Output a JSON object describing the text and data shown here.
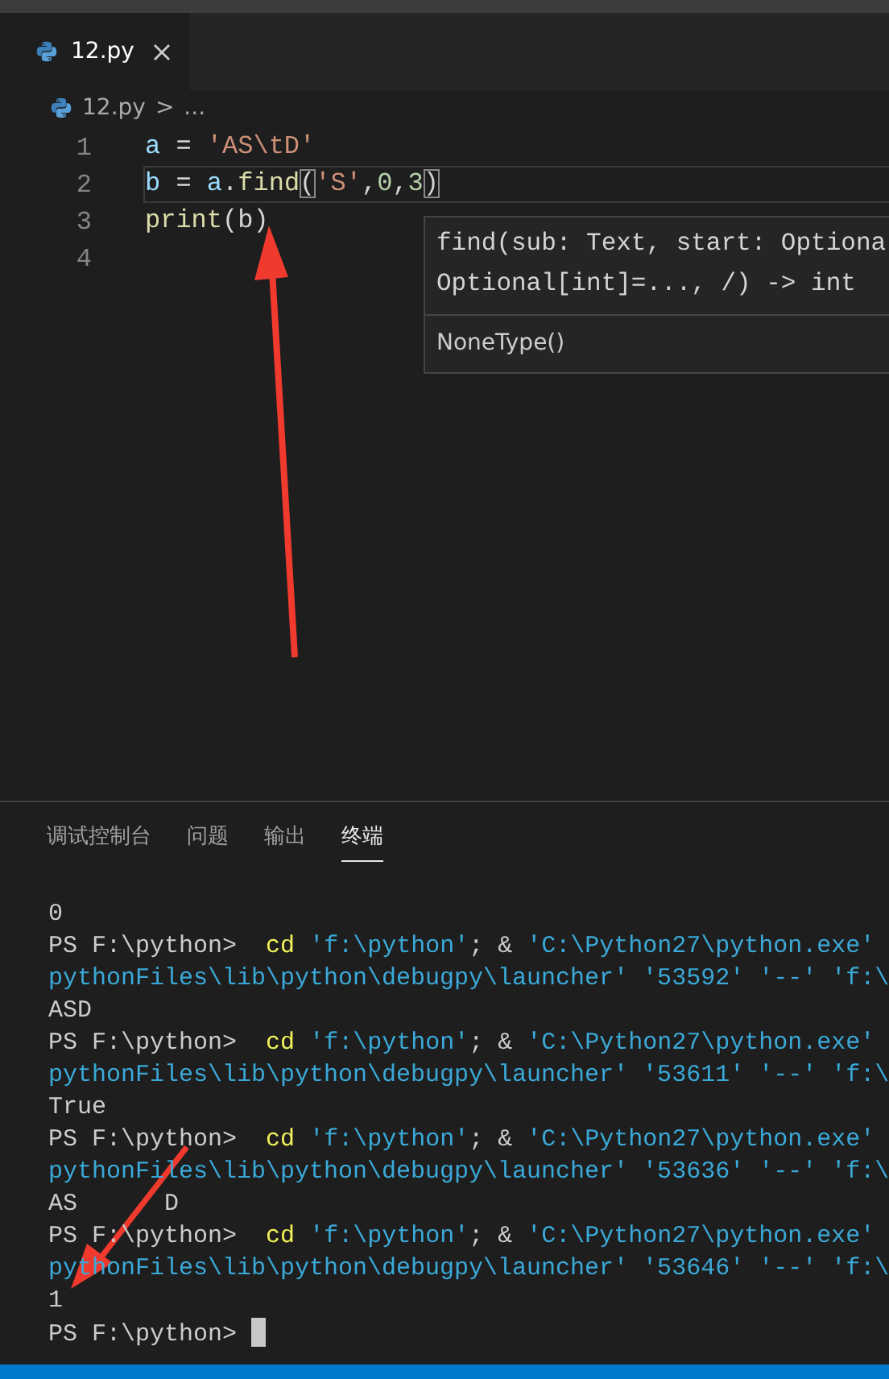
{
  "tabs": [
    {
      "label": "12.py",
      "selected": true
    }
  ],
  "breadcrumb": {
    "file": "12.py",
    "separator": ">",
    "rest": "..."
  },
  "code": [
    {
      "number": "1",
      "current": false,
      "tokens": [
        {
          "kind": "var",
          "text": "a"
        },
        {
          "kind": "op",
          "text": " = "
        },
        {
          "kind": "str",
          "text": "'AS\\tD'"
        }
      ]
    },
    {
      "number": "2",
      "current": true,
      "tokens": [
        {
          "kind": "var",
          "text": "b"
        },
        {
          "kind": "op",
          "text": " = "
        },
        {
          "kind": "var",
          "text": "a"
        },
        {
          "kind": "op",
          "text": "."
        },
        {
          "kind": "fn",
          "text": "find"
        },
        {
          "kind": "bracket",
          "text": "("
        },
        {
          "kind": "str",
          "text": "'S'"
        },
        {
          "kind": "op",
          "text": ","
        },
        {
          "kind": "num",
          "text": "0"
        },
        {
          "kind": "op",
          "text": ","
        },
        {
          "kind": "num",
          "text": "3"
        },
        {
          "kind": "bracket",
          "text": ")"
        }
      ]
    },
    {
      "number": "3",
      "current": false,
      "tokens": [
        {
          "kind": "fn",
          "text": "print"
        },
        {
          "kind": "op",
          "text": "(b)"
        }
      ]
    },
    {
      "number": "4",
      "current": false
    }
  ],
  "hover": {
    "signature": [
      "find(sub: Text, start: Optiona",
      "Optional[int]=..., /) -> int"
    ],
    "doc": "NoneType()"
  },
  "panel_tabs": [
    {
      "label": "调试控制台",
      "selected": false
    },
    {
      "label": "问题",
      "selected": false
    },
    {
      "label": "输出",
      "selected": false
    },
    {
      "label": "终端",
      "selected": true
    }
  ],
  "terminal": [
    {
      "kind": "output",
      "text": "0"
    },
    {
      "kind": "command",
      "prompt": "PS F:\\python>",
      "command": "cd",
      "args": [
        {
          "kind": "str",
          "text": "'f:\\python'"
        },
        {
          "kind": "plain",
          "text": "; & "
        },
        {
          "kind": "str",
          "text": "'C:\\Python27\\python.exe'"
        }
      ]
    },
    {
      "kind": "continuation",
      "text": "pythonFiles\\lib\\python\\debugpy\\launcher' '53592' '--' 'f:\\"
    },
    {
      "kind": "output",
      "text": "ASD"
    },
    {
      "kind": "command",
      "prompt": "PS F:\\python>",
      "command": "cd",
      "args": [
        {
          "kind": "str",
          "text": "'f:\\python'"
        },
        {
          "kind": "plain",
          "text": "; & "
        },
        {
          "kind": "str",
          "text": "'C:\\Python27\\python.exe'"
        }
      ]
    },
    {
      "kind": "continuation",
      "text": "pythonFiles\\lib\\python\\debugpy\\launcher' '53611' '--' 'f:\\"
    },
    {
      "kind": "output",
      "text": "True"
    },
    {
      "kind": "command",
      "prompt": "PS F:\\python>",
      "command": "cd",
      "args": [
        {
          "kind": "str",
          "text": "'f:\\python'"
        },
        {
          "kind": "plain",
          "text": "; & "
        },
        {
          "kind": "str",
          "text": "'C:\\Python27\\python.exe'"
        }
      ]
    },
    {
      "kind": "continuation",
      "text": "pythonFiles\\lib\\python\\debugpy\\launcher' '53636' '--' 'f:\\"
    },
    {
      "kind": "output",
      "text": "AS      D"
    },
    {
      "kind": "command",
      "prompt": "PS F:\\python>",
      "command": "cd",
      "args": [
        {
          "kind": "str",
          "text": "'f:\\python'"
        },
        {
          "kind": "plain",
          "text": "; & "
        },
        {
          "kind": "str",
          "text": "'C:\\Python27\\python.exe'"
        }
      ]
    },
    {
      "kind": "continuation",
      "text": "pythonFiles\\lib\\python\\debugpy\\launcher' '53646' '--' 'f:\\"
    },
    {
      "kind": "output",
      "text": "1"
    },
    {
      "kind": "prompt",
      "prompt": "PS F:\\python>",
      "cursor": true
    }
  ]
}
